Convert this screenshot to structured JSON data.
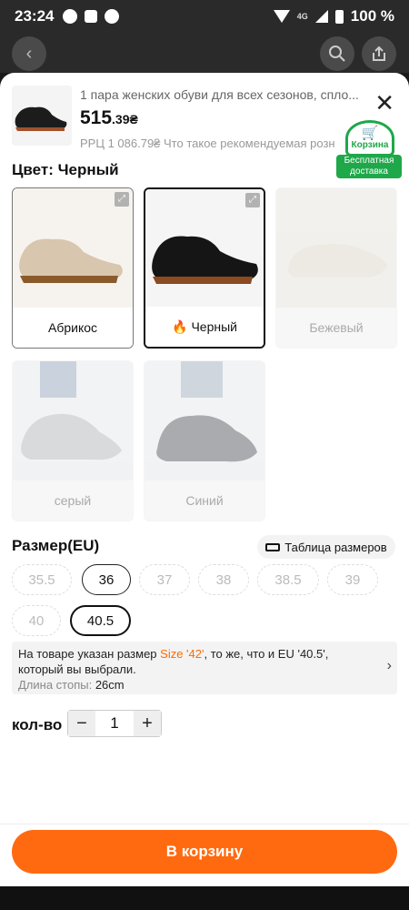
{
  "status_bar": {
    "time": "23:24",
    "network": "4G",
    "battery": "100 %"
  },
  "product": {
    "title": "1 пара женских обуви для всех сезонов, спло...",
    "price_main": "515",
    "price_cents": ".39₴",
    "rrp": "РРЦ 1 086.79₴ Что такое рекомендуемая розн"
  },
  "cart_badge": {
    "label": "Корзина",
    "ribbon": "Бесплатная доставка"
  },
  "color_section": {
    "label": "Цвет: Черный",
    "options": [
      {
        "label": "Абрикос"
      },
      {
        "label": "Черный"
      },
      {
        "label": "Бежевый"
      },
      {
        "label": "серый"
      },
      {
        "label": "Синий"
      }
    ]
  },
  "size_section": {
    "label": "Размер(EU)",
    "table_button": "Таблица размеров",
    "sizes": [
      "35.5",
      "36",
      "37",
      "38",
      "38.5",
      "39",
      "40",
      "40.5"
    ],
    "selected": "40.5"
  },
  "size_note": {
    "text_before": "На товаре указан размер ",
    "highlight": "Size '42'",
    "text_after": ", то же, что и EU '40.5', который вы выбрали.",
    "foot_label": "Длина стопы: ",
    "foot_value": "26cm"
  },
  "quantity": {
    "label": "кол-во",
    "value": "1",
    "minus": "−",
    "plus": "+"
  },
  "add_to_cart": "В корзину"
}
